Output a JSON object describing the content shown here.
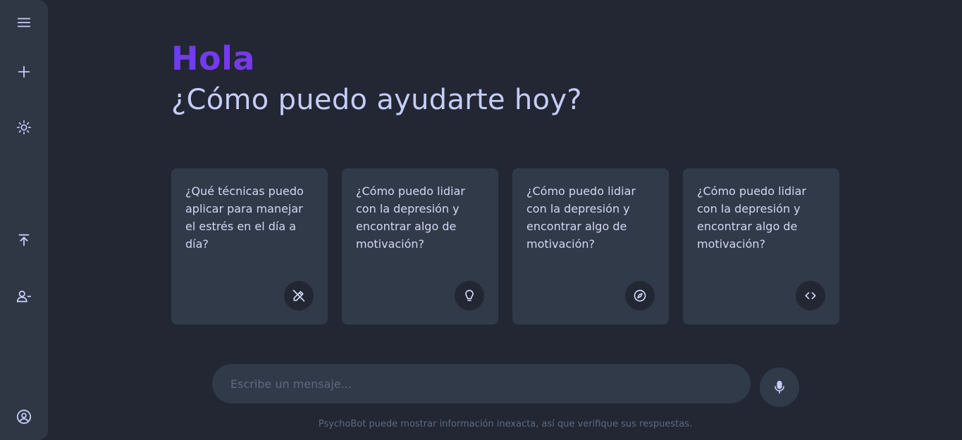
{
  "sidebar": {
    "items": [
      {
        "icon": "menu-icon"
      },
      {
        "icon": "plus-icon"
      },
      {
        "icon": "sun-icon"
      },
      {
        "icon": "upload-icon"
      },
      {
        "icon": "user-minus-icon"
      },
      {
        "icon": "user-circle-icon"
      }
    ]
  },
  "greeting": {
    "hello": "Hola",
    "subtitle": "¿Cómo puedo ayudarte hoy?"
  },
  "cards": [
    {
      "text": "¿Qué técnicas puedo aplicar para manejar el estrés en el día a día?",
      "icon": "pencil-icon"
    },
    {
      "text": "¿Cómo puedo lidiar con la depresión y encontrar algo de motivación?",
      "icon": "lightbulb-icon"
    },
    {
      "text": "¿Cómo puedo lidiar con la depresión y encontrar algo de motivación?",
      "icon": "compass-icon"
    },
    {
      "text": "¿Cómo puedo lidiar con la depresión y encontrar algo de motivación?",
      "icon": "code-icon"
    }
  ],
  "composer": {
    "placeholder": "Escribe un mensaje...",
    "value": ""
  },
  "disclaimer": "PsychoBot puede mostrar información inexacta, así que verifique sus respuestas.",
  "colors": {
    "background": "#222733",
    "panel": "#313a49",
    "accent_start": "#6f3cf0",
    "accent_end": "#9a2fd1",
    "text": "#c6cdf7"
  }
}
